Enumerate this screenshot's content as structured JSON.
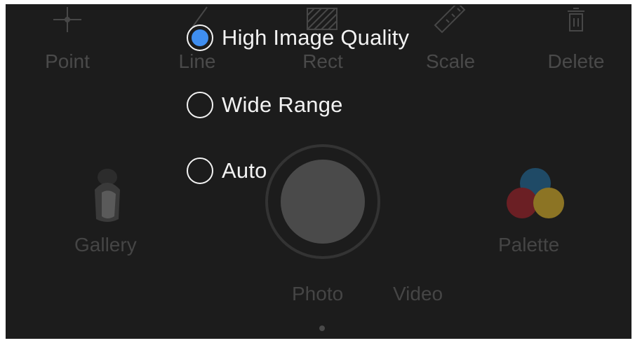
{
  "toolbar": {
    "items": [
      {
        "label": "Point",
        "icon": "crosshair-icon"
      },
      {
        "label": "Line",
        "icon": "line-icon"
      },
      {
        "label": "Rect",
        "icon": "rect-icon"
      },
      {
        "label": "Scale",
        "icon": "ruler-icon"
      },
      {
        "label": "Delete",
        "icon": "trash-icon"
      }
    ]
  },
  "camera": {
    "gallery_label": "Gallery",
    "palette_label": "Palette",
    "modes": [
      "Photo",
      "Video"
    ]
  },
  "quality_menu": {
    "selected": "High Image Quality",
    "options": [
      "High Image Quality",
      "Wide Range",
      "Auto"
    ],
    "accent_color": "#3f8ef0"
  },
  "palette_colors": [
    "#1f4a66",
    "#6b1f24",
    "#8c7424"
  ]
}
